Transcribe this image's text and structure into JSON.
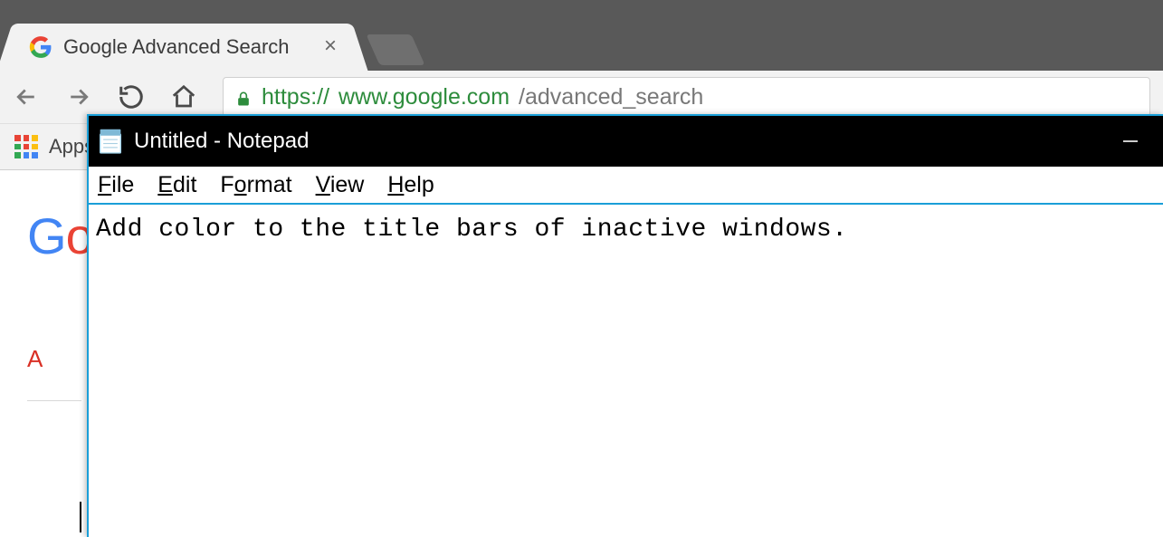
{
  "chrome": {
    "tab": {
      "title": "Google Advanced Search"
    },
    "url": {
      "scheme": "https://",
      "host": "www.google.com",
      "path": "/advanced_search"
    },
    "bookmarks": {
      "apps_label": "Apps"
    },
    "page": {
      "logo_text": "Go",
      "heading_first_char": "A"
    }
  },
  "notepad": {
    "title": "Untitled - Notepad",
    "menus": {
      "file": {
        "hotkey": "F",
        "rest": "ile"
      },
      "edit": {
        "hotkey": "E",
        "rest": "dit"
      },
      "format": {
        "hotkey": "o",
        "pre": "F",
        "rest": "rmat"
      },
      "view": {
        "hotkey": "V",
        "rest": "iew"
      },
      "help": {
        "hotkey": "H",
        "rest": "elp"
      }
    },
    "content": "Add color to the title bars of inactive windows."
  }
}
